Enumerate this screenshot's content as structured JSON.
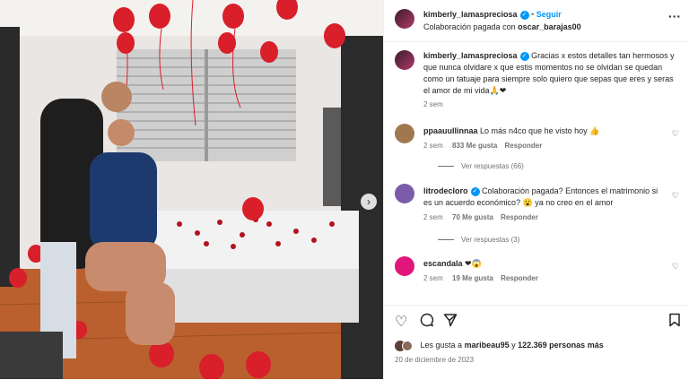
{
  "post": {
    "username": "kimberly_lamaspreciosa",
    "follow_label": "Seguir",
    "paid_partnership": "Colaboración pagada con",
    "partner": "oscar_barajas00",
    "more_icon": "more-horizontal-icon"
  },
  "caption": {
    "username": "kimberly_lamaspreciosa",
    "text": "Gracias x estos detalles tan hermosos y que nunca olvidare x que estis momentos no se olvidan se quedan como un tatuaje para siempre solo quiero que sepas que eres y seras el amor de mi vida🙏❤",
    "time": "2 sem"
  },
  "comments": [
    {
      "username": "ppaauullinnaa",
      "text": "Lo más n4co que he visto hoy 👍",
      "time": "2 sem",
      "likes": "833 Me gusta",
      "reply": "Responder",
      "replies": "Ver respuestas (66)",
      "avatar_color": "#a07850"
    },
    {
      "username": "litrodecloro",
      "text": "Colaboración pagada? Entonces el matrimonio si es un acuerdo económico? 😮 ya no creo en el amor",
      "time": "2 sem",
      "likes": "70 Me gusta",
      "reply": "Responder",
      "replies": "Ver respuestas (3)",
      "avatar_color": "#7b5ca8"
    },
    {
      "username": "escandala",
      "text": "❤😱",
      "time": "2 sem",
      "likes": "19 Me gusta",
      "reply": "Responder",
      "avatar_color": "#e0167a"
    }
  ],
  "actions": {
    "like_icon": "heart-icon",
    "comment_icon": "comment-icon",
    "share_icon": "send-icon",
    "save_icon": "bookmark-icon"
  },
  "likes_summary": {
    "prefix": "Les gusta a",
    "user": "maribeau95",
    "middle": "y",
    "count": "122.369 personas más"
  },
  "date": "20 de diciembre de 2023",
  "colors": {
    "verified": "#0095f6",
    "follow": "#0095f6",
    "balloon": "#d81f2a"
  }
}
